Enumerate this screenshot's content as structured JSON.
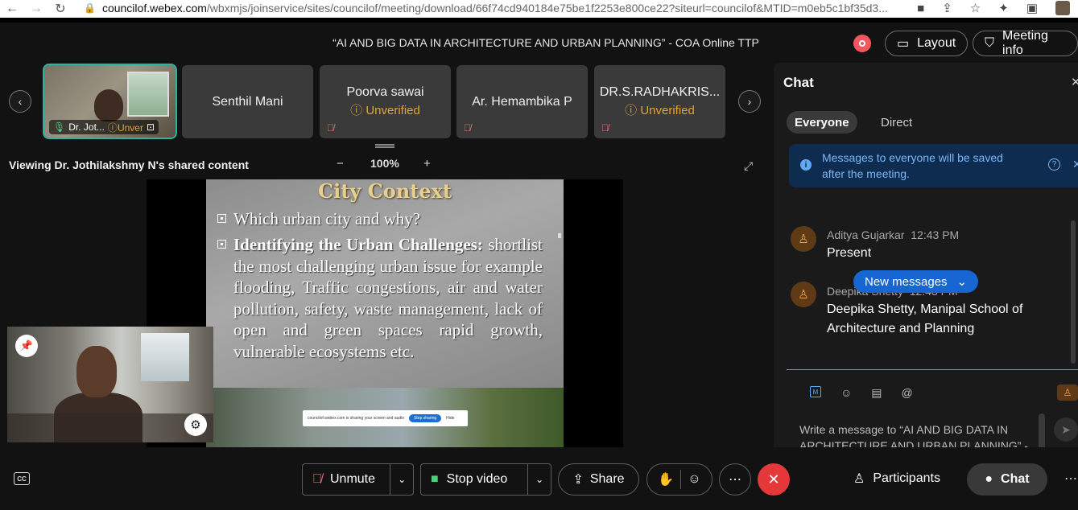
{
  "browser": {
    "url_domain": "councilof.webex.com",
    "url_path": "/wbxmjs/joinservice/sites/councilof/meeting/download/66f74cd940184e75be1f2253e800ce22?siteurl=councilof&MTID=m0eb5c1bf35d3..."
  },
  "header": {
    "meeting_title": "“AI AND BIG DATA IN ARCHITECTURE AND URBAN PLANNING” - COA Online TTP",
    "layout_label": "Layout",
    "meeting_info_label": "Meeting info"
  },
  "participants": [
    {
      "name": "Dr. Jot...",
      "status": "Unver"
    },
    {
      "name": "Senthil Mani",
      "status": ""
    },
    {
      "name": "Poorva sawai",
      "status": "Unverified"
    },
    {
      "name": "Ar. Hemambika P",
      "status": ""
    },
    {
      "name": "DR.S.RADHAKRIS...",
      "status": "Unverified"
    }
  ],
  "share": {
    "viewing_text": "Viewing Dr. Jothilakshmy N's shared content",
    "zoom_out": "−",
    "zoom_level": "100%",
    "zoom_in": "+"
  },
  "slide": {
    "title": "City Context",
    "bullet1": "Which urban city and why?",
    "bullet2_heading": "Identifying the Urban Challenges:",
    "bullet2_body": "shortlist the most challenging urban issue for example flooding, Traffic congestions, air and water pollution, safety, waste management, lack of open and green spaces rapid growth, vulnerable ecosystems etc.",
    "share_notice": "councilof.webex.com is sharing your screen and audio",
    "stop_sharing": "Stop sharing",
    "hide": "Hide"
  },
  "controls": {
    "unmute": "Unmute",
    "stop_video": "Stop video",
    "share": "Share",
    "participants": "Participants",
    "chat": "Chat"
  },
  "chat": {
    "title": "Chat",
    "tab_everyone": "Everyone",
    "tab_direct": "Direct",
    "notice": "Messages to everyone will be saved after the meeting.",
    "messages": [
      {
        "sender": "Aditya Gujarkar",
        "time": "12:43 PM",
        "text": "Present"
      },
      {
        "sender": "Deepika Shetty",
        "time": "12:43 PM",
        "text": "Deepika Shetty, Manipal School of Architecture and Planning"
      }
    ],
    "new_messages": "New messages",
    "composer_placeholder": "Write a message to “AI AND BIG DATA IN ARCHITECTURE AND URBAN PLANNING” -"
  },
  "colors": {
    "accent_teal": "#2bb3a2",
    "unverified": "#e3a339",
    "leave_red": "#e5383b",
    "new_messages_blue": "#1766d1"
  }
}
